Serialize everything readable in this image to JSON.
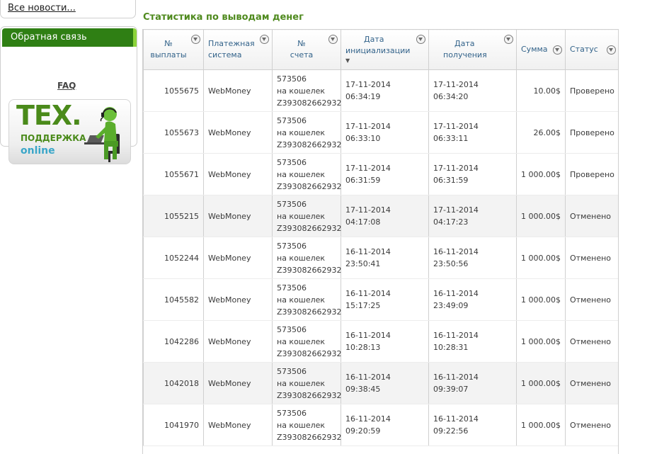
{
  "sidebar": {
    "all_news": "Все новости...",
    "feedback_title": "Обратная связь",
    "faq": "FAQ",
    "banner": {
      "line1": "ТЕХ.",
      "line2": "ПОДДЕРЖКА",
      "line3": "online"
    }
  },
  "main": {
    "title": "Статистика по выводам денег",
    "columns": [
      {
        "line1": "№",
        "line2": "выплаты"
      },
      {
        "line1": "Платежная",
        "line2": "система"
      },
      {
        "line1": "№",
        "line2": "счета"
      },
      {
        "line1": "Дата",
        "line2": "инициализации"
      },
      {
        "line1": "Дата",
        "line2": "получения"
      },
      {
        "line1": "Сумма",
        "line2": ""
      },
      {
        "line1": "Статус",
        "line2": ""
      }
    ],
    "rows": [
      {
        "id": "1055675",
        "system": "WebMoney",
        "acct1": "573506",
        "acct2": "на кошелек",
        "acct3": "Z393082662932",
        "init": "17-11-2014 06:34:19",
        "recv": "17-11-2014 06:34:20",
        "sum": "10.00$",
        "status": "Проверено"
      },
      {
        "id": "1055673",
        "system": "WebMoney",
        "acct1": "573506",
        "acct2": "на кошелек",
        "acct3": "Z393082662932",
        "init": "17-11-2014 06:33:10",
        "recv": "17-11-2014 06:33:11",
        "sum": "26.00$",
        "status": "Проверено"
      },
      {
        "id": "1055671",
        "system": "WebMoney",
        "acct1": "573506",
        "acct2": "на кошелек",
        "acct3": "Z393082662932",
        "init": "17-11-2014 06:31:59",
        "recv": "17-11-2014 06:31:59",
        "sum": "1 000.00$",
        "status": "Проверено"
      },
      {
        "id": "1055215",
        "system": "WebMoney",
        "acct1": "573506",
        "acct2": "на кошелек",
        "acct3": "Z393082662932",
        "init": "17-11-2014 04:17:08",
        "recv": "17-11-2014 04:17:23",
        "sum": "1 000.00$",
        "status": "Отменено"
      },
      {
        "id": "1052244",
        "system": "WebMoney",
        "acct1": "573506",
        "acct2": "на кошелек",
        "acct3": "Z393082662932",
        "init": "16-11-2014 23:50:41",
        "recv": "16-11-2014 23:50:56",
        "sum": "1 000.00$",
        "status": "Отменено"
      },
      {
        "id": "1045582",
        "system": "WebMoney",
        "acct1": "573506",
        "acct2": "на кошелек",
        "acct3": "Z393082662932",
        "init": "16-11-2014 15:17:25",
        "recv": "16-11-2014 23:49:09",
        "sum": "1 000.00$",
        "status": "Отменено"
      },
      {
        "id": "1042286",
        "system": "WebMoney",
        "acct1": "573506",
        "acct2": "на кошелек",
        "acct3": "Z393082662932",
        "init": "16-11-2014 10:28:13",
        "recv": "16-11-2014 10:28:31",
        "sum": "1 000.00$",
        "status": "Отменено"
      },
      {
        "id": "1042018",
        "system": "WebMoney",
        "acct1": "573506",
        "acct2": "на кошелек",
        "acct3": "Z393082662932",
        "init": "16-11-2014 09:38:45",
        "recv": "16-11-2014 09:39:07",
        "sum": "1 000.00$",
        "status": "Отменено"
      },
      {
        "id": "1041970",
        "system": "WebMoney",
        "acct1": "573506",
        "acct2": "на кошелек",
        "acct3": "Z393082662932",
        "init": "16-11-2014 09:20:59",
        "recv": "16-11-2014 09:22:56",
        "sum": "1 000.00$",
        "status": "Отменено"
      }
    ]
  },
  "colors": {
    "brand_green": "#2f7f14",
    "title_green": "#4f8a1e",
    "header_text": "#33638a",
    "accent_light_green": "#8cd43a"
  },
  "icons": {
    "filter": "filter-icon",
    "sort": "sort-desc-icon",
    "support": "headset-operator-icon"
  }
}
